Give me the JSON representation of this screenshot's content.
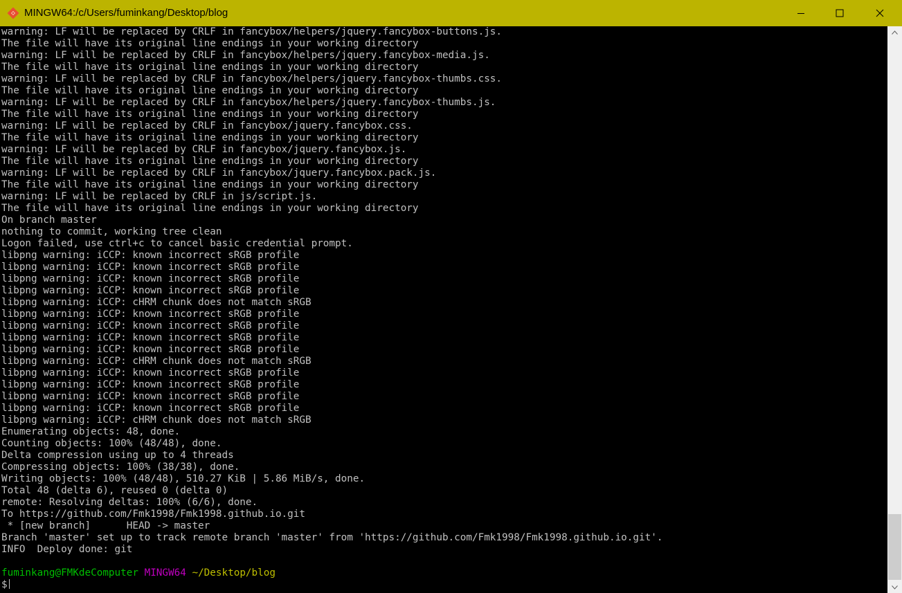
{
  "window": {
    "title": "MINGW64:/c/Users/fuminkang/Desktop/blog",
    "title_bar_color": "#bcb400",
    "buttons": {
      "minimize": "minimize-icon",
      "maximize": "maximize-icon",
      "close": "close-icon"
    }
  },
  "terminal": {
    "background": "#000000",
    "lines": [
      "warning: LF will be replaced by CRLF in fancybox/helpers/jquery.fancybox-buttons.js.",
      "The file will have its original line endings in your working directory",
      "warning: LF will be replaced by CRLF in fancybox/helpers/jquery.fancybox-media.js.",
      "The file will have its original line endings in your working directory",
      "warning: LF will be replaced by CRLF in fancybox/helpers/jquery.fancybox-thumbs.css.",
      "The file will have its original line endings in your working directory",
      "warning: LF will be replaced by CRLF in fancybox/helpers/jquery.fancybox-thumbs.js.",
      "The file will have its original line endings in your working directory",
      "warning: LF will be replaced by CRLF in fancybox/jquery.fancybox.css.",
      "The file will have its original line endings in your working directory",
      "warning: LF will be replaced by CRLF in fancybox/jquery.fancybox.js.",
      "The file will have its original line endings in your working directory",
      "warning: LF will be replaced by CRLF in fancybox/jquery.fancybox.pack.js.",
      "The file will have its original line endings in your working directory",
      "warning: LF will be replaced by CRLF in js/script.js.",
      "The file will have its original line endings in your working directory",
      "On branch master",
      "nothing to commit, working tree clean",
      "Logon failed, use ctrl+c to cancel basic credential prompt.",
      "libpng warning: iCCP: known incorrect sRGB profile",
      "libpng warning: iCCP: known incorrect sRGB profile",
      "libpng warning: iCCP: known incorrect sRGB profile",
      "libpng warning: iCCP: known incorrect sRGB profile",
      "libpng warning: iCCP: cHRM chunk does not match sRGB",
      "libpng warning: iCCP: known incorrect sRGB profile",
      "libpng warning: iCCP: known incorrect sRGB profile",
      "libpng warning: iCCP: known incorrect sRGB profile",
      "libpng warning: iCCP: known incorrect sRGB profile",
      "libpng warning: iCCP: cHRM chunk does not match sRGB",
      "libpng warning: iCCP: known incorrect sRGB profile",
      "libpng warning: iCCP: known incorrect sRGB profile",
      "libpng warning: iCCP: known incorrect sRGB profile",
      "libpng warning: iCCP: known incorrect sRGB profile",
      "libpng warning: iCCP: cHRM chunk does not match sRGB",
      "Enumerating objects: 48, done.",
      "Counting objects: 100% (48/48), done.",
      "Delta compression using up to 4 threads",
      "Compressing objects: 100% (38/38), done.",
      "Writing objects: 100% (48/48), 510.27 KiB | 5.86 MiB/s, done.",
      "Total 48 (delta 6), reused 0 (delta 0)",
      "remote: Resolving deltas: 100% (6/6), done.",
      "To https://github.com/Fmk1998/Fmk1998.github.io.git",
      " * [new branch]      HEAD -> master",
      "Branch 'master' set up to track remote branch 'master' from 'https://github.com/Fmk1998/Fmk1998.github.io.git'.",
      "INFO  Deploy done: git",
      ""
    ],
    "prompt": {
      "user_host": "fuminkang@FMKdeComputer",
      "shell": "MINGW64",
      "path": "~/Desktop/blog",
      "symbol": "$",
      "user_color": "#00bf00",
      "shell_color": "#bf00bf",
      "path_color": "#bfbf00"
    }
  },
  "scrollbar": {
    "up_icon": "scroll-up-arrow-icon",
    "down_icon": "scroll-down-arrow-icon"
  }
}
